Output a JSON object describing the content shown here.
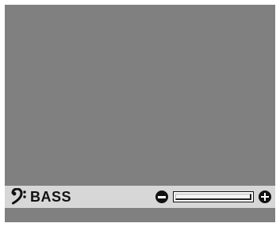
{
  "osd": {
    "label": "BASS",
    "icon": "bass-clef-icon",
    "level_fraction": 0.0,
    "colors": {
      "screen": "#808080",
      "bar": "#d7d7d7",
      "text": "#111111"
    }
  },
  "controls": {
    "decrease_icon": "minus-circle-icon",
    "increase_icon": "plus-circle-icon"
  }
}
